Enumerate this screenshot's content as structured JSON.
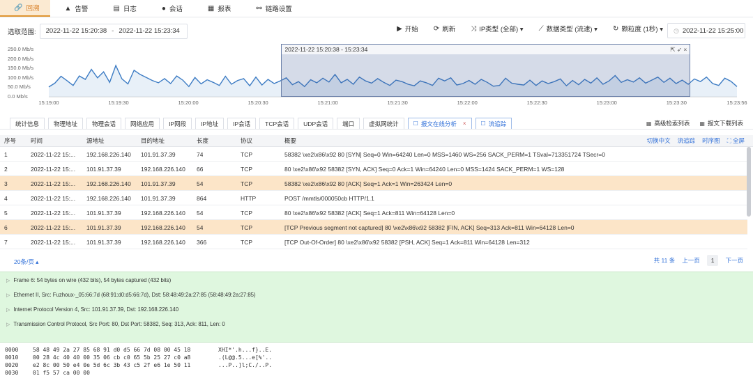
{
  "nav": {
    "items": [
      {
        "icon": "link-icon",
        "glyph": "🔗",
        "label": "回溯",
        "active": true
      },
      {
        "icon": "alert-icon",
        "glyph": "▲",
        "label": "告警",
        "active": false
      },
      {
        "icon": "log-icon",
        "glyph": "▤",
        "label": "日志",
        "active": false
      },
      {
        "icon": "chat-icon",
        "glyph": "●",
        "label": "会话",
        "active": false
      },
      {
        "icon": "report-icon",
        "glyph": "▦",
        "label": "报表",
        "active": false
      },
      {
        "icon": "chain-icon",
        "glyph": "⚯",
        "label": "链路设置",
        "active": false
      }
    ],
    "active_color": "#d9822b"
  },
  "filter": {
    "label": "选取范围:",
    "start": "2022-11-22 15:20:38",
    "separator": "-",
    "end": "2022-11-22 15:23:34",
    "tools": [
      {
        "icon": "play-icon",
        "glyph": "▶",
        "label": "开始"
      },
      {
        "icon": "refresh-icon",
        "glyph": "⟳",
        "label": "刷新"
      },
      {
        "icon": "shuffle-icon",
        "glyph": "⤨",
        "label": "IP类型 (全部) ▾"
      },
      {
        "icon": "linechart-icon",
        "glyph": "⟋",
        "label": "数据类型 (流速) ▾"
      },
      {
        "icon": "granularity-icon",
        "glyph": "↻",
        "label": "颗粒度 (1秒) ▾"
      }
    ],
    "now": "2022-11-22 15:25:00"
  },
  "chart_data": {
    "type": "area",
    "y_ticks": [
      "250.0 Mb/s",
      "200.0 Mb/s",
      "150.0 Mb/s",
      "100.0 Mb/s",
      "50.0 Mb/s",
      "0.0 Mb/s"
    ],
    "ylim": [
      0,
      250
    ],
    "x_ticks": [
      "15:19:00",
      "15:19:30",
      "15:20:00",
      "15:20:30",
      "15:21:00",
      "15:21:30",
      "15:22:00",
      "15:22:30",
      "15:23:00",
      "15:23:30",
      "15:23:56"
    ],
    "x_tick_seconds": [
      0,
      30,
      60,
      90,
      120,
      150,
      180,
      210,
      240,
      270,
      296
    ],
    "values": [
      52,
      72,
      108,
      85,
      60,
      110,
      92,
      145,
      100,
      132,
      76,
      165,
      95,
      68,
      140,
      118,
      102,
      86,
      74,
      96,
      70,
      110,
      88,
      54,
      102,
      68,
      90,
      76,
      60,
      108,
      66,
      86,
      96,
      58,
      104,
      62,
      92,
      70,
      84,
      100,
      64,
      80,
      54,
      90,
      74,
      98,
      78,
      118,
      74,
      92,
      66,
      104,
      84,
      72,
      96,
      76,
      60,
      88,
      80,
      66,
      58,
      84,
      74,
      60,
      98,
      84,
      100,
      62,
      70,
      86,
      66,
      92,
      76,
      56,
      60,
      98,
      72,
      66,
      62,
      88,
      60,
      84,
      70,
      80,
      94,
      58,
      86,
      64,
      92,
      72,
      100,
      66,
      84,
      112,
      76,
      90,
      78,
      100,
      72,
      88,
      104,
      76,
      98,
      70,
      88,
      66,
      94,
      80,
      104,
      70,
      60,
      98,
      82,
      54
    ],
    "selection": {
      "start_s": 100,
      "end_s": 276,
      "label": "2022-11-22 15:20:38 - 15:23:34"
    },
    "line_color": "#3d7cc4",
    "fill_color": "#d6e3f3",
    "selection_color": "#425d96"
  },
  "selection_icons": "⇱ ➶ ×",
  "tabs": {
    "items": [
      {
        "label": "统计信息"
      },
      {
        "label": "物理地址"
      },
      {
        "label": "物理会话"
      },
      {
        "label": "网络应用"
      },
      {
        "label": "IP网段"
      },
      {
        "label": "IP地址"
      },
      {
        "label": "IP会话"
      },
      {
        "label": "TCP会话"
      },
      {
        "label": "UDP会话"
      },
      {
        "label": "端口"
      },
      {
        "label": "虚拟网统计"
      },
      {
        "label": "报文在线分析",
        "active": true,
        "closable": true,
        "icon": "☐"
      },
      {
        "label": "流追踪",
        "active": true,
        "icon": "☐"
      }
    ],
    "right": [
      {
        "icon": "grid-icon",
        "glyph": "▦",
        "label": "高级检索列表"
      },
      {
        "icon": "grid-icon",
        "glyph": "▦",
        "label": "报文下载列表"
      }
    ]
  },
  "table": {
    "headers": [
      "序号",
      "时间",
      "源地址",
      "目的地址",
      "长度",
      "协议",
      "概要"
    ],
    "actions": [
      "切换中文",
      "流追踪",
      "时序图",
      "⛶ 全屏"
    ],
    "rows": [
      {
        "no": "1",
        "time": "2022-11-22 15:...",
        "src": "192.168.226.140",
        "dst": "101.91.37.39",
        "len": "74",
        "proto": "TCP",
        "summary": "58382 \\xe2\\x86\\x92 80 [SYN] Seq=0 Win=64240 Len=0 MSS=1460 WS=256 SACK_PERM=1 TSval=713351724 TSecr=0",
        "hl": false
      },
      {
        "no": "2",
        "time": "2022-11-22 15:...",
        "src": "101.91.37.39",
        "dst": "192.168.226.140",
        "len": "66",
        "proto": "TCP",
        "summary": "80 \\xe2\\x86\\x92 58382 [SYN, ACK] Seq=0 Ack=1 Win=64240 Len=0 MSS=1424 SACK_PERM=1 WS=128",
        "hl": false
      },
      {
        "no": "3",
        "time": "2022-11-22 15:...",
        "src": "192.168.226.140",
        "dst": "101.91.37.39",
        "len": "54",
        "proto": "TCP",
        "summary": "58382 \\xe2\\x86\\x92 80 [ACK] Seq=1 Ack=1 Win=263424 Len=0",
        "hl": true
      },
      {
        "no": "4",
        "time": "2022-11-22 15:...",
        "src": "192.168.226.140",
        "dst": "101.91.37.39",
        "len": "864",
        "proto": "HTTP",
        "summary": "POST /mmtls/000050cb HTTP/1.1",
        "hl": false
      },
      {
        "no": "5",
        "time": "2022-11-22 15:...",
        "src": "101.91.37.39",
        "dst": "192.168.226.140",
        "len": "54",
        "proto": "TCP",
        "summary": "80 \\xe2\\x86\\x92 58382 [ACK] Seq=1 Ack=811 Win=64128 Len=0",
        "hl": false
      },
      {
        "no": "6",
        "time": "2022-11-22 15:...",
        "src": "101.91.37.39",
        "dst": "192.168.226.140",
        "len": "54",
        "proto": "TCP",
        "summary": "[TCP Previous segment not captured] 80 \\xe2\\x86\\x92 58382 [FIN, ACK] Seq=313 Ack=811 Win=64128 Len=0",
        "hl": true
      },
      {
        "no": "7",
        "time": "2022-11-22 15:...",
        "src": "101.91.37.39",
        "dst": "192.168.226.140",
        "len": "366",
        "proto": "TCP",
        "summary": "[TCP Out-Of-Order] 80 \\xe2\\x86\\x92 58382 [PSH, ACK] Seq=1 Ack=811 Win=64128 Len=312",
        "hl": false
      }
    ]
  },
  "pager": {
    "page_size": "20条/页 ▴",
    "total": "共 11 条",
    "prev": "上一页",
    "current": "1",
    "next": "下一页"
  },
  "detail": [
    "Frame 6: 54 bytes on wire (432 bits), 54 bytes captured (432 bits)",
    "Ethernet II, Src: Fuzhoux-_05:66:7d (68:91:d0:d5:66:7d), Dst: 58:48:49:2a:27:85 (58:48:49:2a:27:85)",
    "Internet Protocol Version 4, Src: 101.91.37.39, Dst: 192.168.226.140",
    "Transmission Control Protocol, Src Port: 80, Dst Port: 58382, Seq: 313, Ack: 811, Len: 0"
  ],
  "hex": [
    {
      "offset": "0000",
      "bytes": "58 48 49 2a 27 85 68 91 d0 d5 66 7d 08 00 45 18",
      "ascii": "XHI*'.h...f}..E."
    },
    {
      "offset": "0010",
      "bytes": "00 28 4c 40 40 00 35 06 cb c0 65 5b 25 27 c0 a8",
      "ascii": ".(L@@.5...e[%'.."
    },
    {
      "offset": "0020",
      "bytes": "e2 8c 00 50 e4 0e 5d 6c 3b 43 c5 2f e6 1e 50 11",
      "ascii": "...P..]l;C./..P."
    },
    {
      "offset": "0030",
      "bytes": "01 f5 57 ca 00 00",
      "ascii": ""
    }
  ]
}
